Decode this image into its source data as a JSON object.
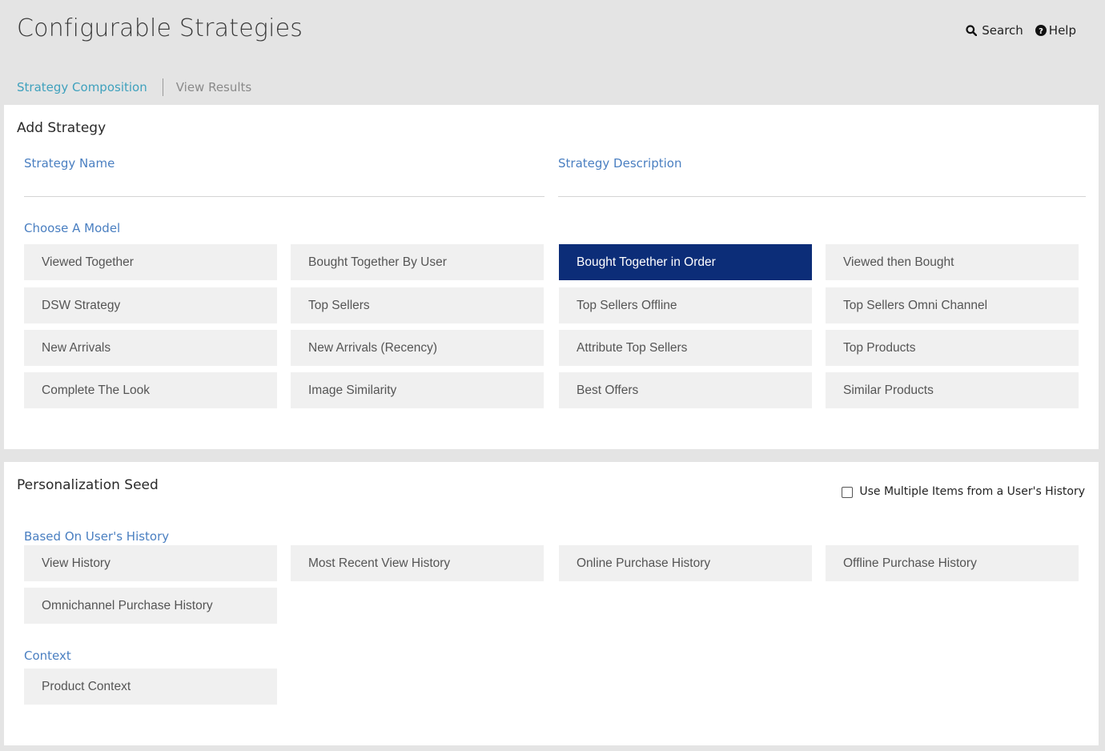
{
  "header": {
    "title": "Configurable Strategies",
    "search_label": "Search",
    "help_label": "Help",
    "search_icon": "search-icon",
    "help_icon": "help-circle-icon"
  },
  "tabs": [
    {
      "label": "Strategy Composition",
      "active": true
    },
    {
      "label": "View Results",
      "active": false
    }
  ],
  "add_strategy": {
    "title": "Add Strategy",
    "name_label": "Strategy Name",
    "name_value": "",
    "description_label": "Strategy Description",
    "description_value": "",
    "model_label": "Choose A Model",
    "models": [
      {
        "label": "Viewed Together",
        "selected": false
      },
      {
        "label": "Bought Together By User",
        "selected": false
      },
      {
        "label": "Bought Together in Order",
        "selected": true
      },
      {
        "label": "Viewed then Bought",
        "selected": false
      },
      {
        "label": "DSW Strategy",
        "selected": false
      },
      {
        "label": "Top Sellers",
        "selected": false
      },
      {
        "label": "Top Sellers Offline",
        "selected": false
      },
      {
        "label": "Top Sellers Omni Channel",
        "selected": false
      },
      {
        "label": "New Arrivals",
        "selected": false
      },
      {
        "label": "New Arrivals (Recency)",
        "selected": false
      },
      {
        "label": "Attribute Top Sellers",
        "selected": false
      },
      {
        "label": "Top Products",
        "selected": false
      },
      {
        "label": "Complete The Look",
        "selected": false
      },
      {
        "label": "Image Similarity",
        "selected": false
      },
      {
        "label": "Best Offers",
        "selected": false
      },
      {
        "label": "Similar Products",
        "selected": false
      }
    ]
  },
  "personalization_seed": {
    "title": "Personalization Seed",
    "multi_items_label": "Use Multiple Items from a User's History",
    "multi_items_checked": false,
    "history_label": "Based On User's History",
    "history_options": [
      {
        "label": "View History"
      },
      {
        "label": "Most Recent View History"
      },
      {
        "label": "Online Purchase History"
      },
      {
        "label": "Offline Purchase History"
      },
      {
        "label": "Omnichannel Purchase History"
      }
    ],
    "context_label": "Context",
    "context_options": [
      {
        "label": "Product Context"
      }
    ]
  },
  "colors": {
    "accent": "#3fa1bd",
    "label_blue": "#4a7fc1",
    "selected_bg": "#0c2d78",
    "option_bg": "#f0f0f0",
    "page_bg": "#e4e4e4"
  }
}
